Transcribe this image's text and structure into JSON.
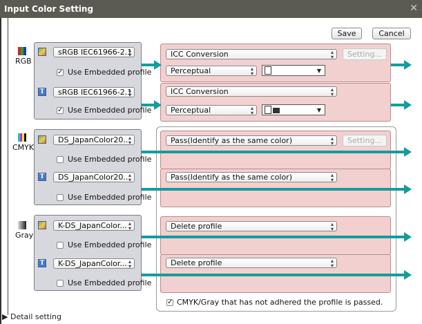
{
  "window": {
    "title": "Input Color Setting"
  },
  "toolbar": {
    "save_label": "Save",
    "cancel_label": "Cancel"
  },
  "groups": {
    "rgb": {
      "label": "RGB",
      "image": {
        "profile": "sRGB IEC61966-2.1",
        "use_embedded_label": "Use Embedded profile",
        "use_embedded_checked": true
      },
      "text": {
        "profile": "sRGB IEC61966-2.1",
        "use_embedded_label": "Use Embedded profile",
        "use_embedded_checked": true
      },
      "out_image": {
        "method": "ICC Conversion",
        "intent": "Perceptual",
        "setting_label": "Setting..."
      },
      "out_text": {
        "method": "ICC Conversion",
        "intent": "Perceptual"
      }
    },
    "cmyk": {
      "label": "CMYK",
      "image": {
        "profile": "DS_JapanColor20...",
        "use_embedded_label": "Use Embedded profile",
        "use_embedded_checked": false
      },
      "text": {
        "profile": "DS_JapanColor20...",
        "use_embedded_label": "Use Embedded profile",
        "use_embedded_checked": false
      },
      "out_image": {
        "method": "Pass(Identify as the same color)",
        "setting_label": "Setting..."
      },
      "out_text": {
        "method": "Pass(Identify as the same color)"
      }
    },
    "gray": {
      "label": "Gray",
      "image": {
        "profile": "K-DS_JapanColor...",
        "use_embedded_label": "Use Embedded profile",
        "use_embedded_checked": false
      },
      "text": {
        "profile": "K-DS_JapanColor...",
        "use_embedded_label": "Use Embedded profile",
        "use_embedded_checked": false
      },
      "out_image": {
        "method": "Delete profile"
      },
      "out_text": {
        "method": "Delete profile"
      }
    }
  },
  "passthrough": {
    "label": "CMYK/Gray that has not adhered the profile is passed.",
    "checked": true
  },
  "detail": {
    "label": "Detail setting"
  },
  "colors": {
    "arrow": "#159c9c",
    "source_box": "#d7d7de",
    "output_box": "#f2d0d0",
    "titlebar": "#5b5b53"
  },
  "icons": {
    "close": "close-icon",
    "image_kind": "image-icon",
    "text_kind": "text-icon",
    "dropdown": "dropdown-arrow-icon"
  }
}
